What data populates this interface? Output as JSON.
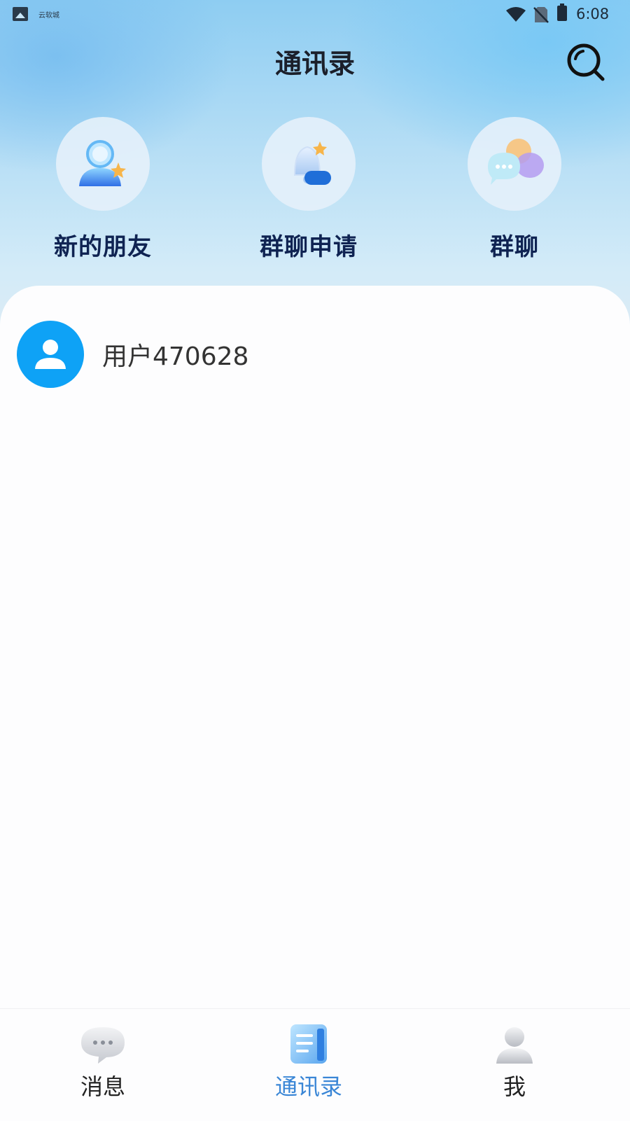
{
  "status_bar": {
    "app_label": "云软城",
    "time": "6:08"
  },
  "header": {
    "title": "通讯录"
  },
  "shortcuts": [
    {
      "label": "新的朋友",
      "icon": "new-friend-icon"
    },
    {
      "label": "群聊申请",
      "icon": "bell-icon"
    },
    {
      "label": "群聊",
      "icon": "chat-bubbles-icon"
    }
  ],
  "contacts": [
    {
      "name": "用户470628",
      "avatar_color": "#0ea2f6"
    }
  ],
  "tabbar": {
    "items": [
      {
        "label": "消息",
        "icon": "message-icon"
      },
      {
        "label": "通讯录",
        "icon": "contacts-icon",
        "active": true
      },
      {
        "label": "我",
        "icon": "profile-icon"
      }
    ],
    "active_color": "#3a86d6"
  },
  "colors": {
    "accent": "#0ea2f6",
    "title_text": "#0f2352"
  }
}
